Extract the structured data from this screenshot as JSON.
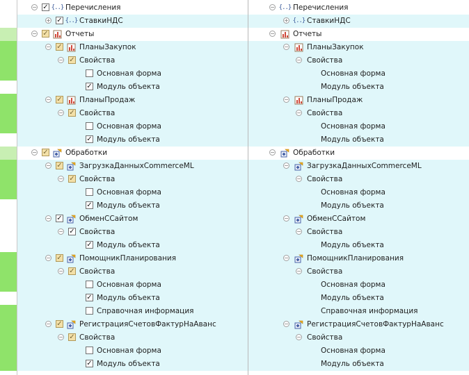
{
  "colors": {
    "row_highlight": "#e0f7fa",
    "gutter_changed": "#8fe36a",
    "gutter_changed_light": "#c8efb3"
  },
  "rows": [
    {
      "level": 0,
      "expander": "minus",
      "check": "checked",
      "icon": "enum-icon",
      "left_label": "Перечисления",
      "right_label": "Перечисления",
      "highlight": false,
      "gutter": "none"
    },
    {
      "level": 1,
      "expander": "plus",
      "check": "checked",
      "icon": "enum-icon",
      "left_label": "СтавкиНДС",
      "right_label": "СтавкиНДС",
      "highlight": true,
      "gutter": "none"
    },
    {
      "level": 0,
      "expander": "minus",
      "check": "partial",
      "icon": "report-icon",
      "left_label": "Отчеты",
      "right_label": "Отчеты",
      "highlight": false,
      "gutter": "light"
    },
    {
      "level": 1,
      "expander": "minus",
      "check": "partial",
      "icon": "report-icon",
      "left_label": "ПланыЗакупок",
      "right_label": "ПланыЗакупок",
      "highlight": true,
      "gutter": "strong"
    },
    {
      "level": 2,
      "expander": "minus",
      "check": "partial",
      "icon": "",
      "left_label": "Свойства",
      "right_label": "Свойства",
      "highlight": true,
      "gutter": "strong"
    },
    {
      "level": 3,
      "expander": "",
      "check": "unchecked",
      "icon": "",
      "left_label": "Основная форма",
      "right_label": "Основная форма",
      "highlight": true,
      "gutter": "strong"
    },
    {
      "level": 3,
      "expander": "",
      "check": "checked",
      "icon": "",
      "left_label": "Модуль объекта",
      "right_label": "Модуль объекта",
      "highlight": true,
      "gutter": "none"
    },
    {
      "level": 1,
      "expander": "minus",
      "check": "partial",
      "icon": "report-icon",
      "left_label": "ПланыПродаж",
      "right_label": "ПланыПродаж",
      "highlight": true,
      "gutter": "strong"
    },
    {
      "level": 2,
      "expander": "minus",
      "check": "partial",
      "icon": "",
      "left_label": "Свойства",
      "right_label": "Свойства",
      "highlight": true,
      "gutter": "strong"
    },
    {
      "level": 3,
      "expander": "",
      "check": "unchecked",
      "icon": "",
      "left_label": "Основная форма",
      "right_label": "Основная форма",
      "highlight": true,
      "gutter": "strong"
    },
    {
      "level": 3,
      "expander": "",
      "check": "checked",
      "icon": "",
      "left_label": "Модуль объекта",
      "right_label": "Модуль объекта",
      "highlight": true,
      "gutter": "none"
    },
    {
      "level": 0,
      "expander": "minus",
      "check": "partial",
      "icon": "processing-icon",
      "left_label": "Обработки",
      "right_label": "Обработки",
      "highlight": false,
      "gutter": "light"
    },
    {
      "level": 1,
      "expander": "minus",
      "check": "partial",
      "icon": "processing-icon",
      "left_label": "ЗагрузкаДанныхCommerceML",
      "right_label": "ЗагрузкаДанныхCommerceML",
      "highlight": true,
      "gutter": "strong"
    },
    {
      "level": 2,
      "expander": "minus",
      "check": "partial",
      "icon": "",
      "left_label": "Свойства",
      "right_label": "Свойства",
      "highlight": true,
      "gutter": "strong"
    },
    {
      "level": 3,
      "expander": "",
      "check": "unchecked",
      "icon": "",
      "left_label": "Основная форма",
      "right_label": "Основная форма",
      "highlight": true,
      "gutter": "strong"
    },
    {
      "level": 3,
      "expander": "",
      "check": "checked",
      "icon": "",
      "left_label": "Модуль объекта",
      "right_label": "Модуль объекта",
      "highlight": true,
      "gutter": "none"
    },
    {
      "level": 1,
      "expander": "minus",
      "check": "checked",
      "icon": "processing-icon",
      "left_label": "ОбменССайтом",
      "right_label": "ОбменССайтом",
      "highlight": true,
      "gutter": "none"
    },
    {
      "level": 2,
      "expander": "minus",
      "check": "checked",
      "icon": "",
      "left_label": "Свойства",
      "right_label": "Свойства",
      "highlight": true,
      "gutter": "none"
    },
    {
      "level": 3,
      "expander": "",
      "check": "checked",
      "icon": "",
      "left_label": "Модуль объекта",
      "right_label": "Модуль объекта",
      "highlight": true,
      "gutter": "none"
    },
    {
      "level": 1,
      "expander": "minus",
      "check": "partial",
      "icon": "processing-icon",
      "left_label": "ПомощникПланирования",
      "right_label": "ПомощникПланирования",
      "highlight": true,
      "gutter": "strong"
    },
    {
      "level": 2,
      "expander": "minus",
      "check": "partial",
      "icon": "",
      "left_label": "Свойства",
      "right_label": "Свойства",
      "highlight": true,
      "gutter": "strong"
    },
    {
      "level": 3,
      "expander": "",
      "check": "unchecked",
      "icon": "",
      "left_label": "Основная форма",
      "right_label": "Основная форма",
      "highlight": true,
      "gutter": "strong"
    },
    {
      "level": 3,
      "expander": "",
      "check": "checked",
      "icon": "",
      "left_label": "Модуль объекта",
      "right_label": "Модуль объекта",
      "highlight": true,
      "gutter": "none"
    },
    {
      "level": 3,
      "expander": "",
      "check": "unchecked",
      "icon": "",
      "left_label": "Справочная информация",
      "right_label": "Справочная информация",
      "highlight": true,
      "gutter": "strong"
    },
    {
      "level": 1,
      "expander": "minus",
      "check": "partial",
      "icon": "processing-icon",
      "left_label": "РегистрацияСчетовФактурНаАванс",
      "right_label": "РегистрацияСчетовФактурНаАванс",
      "highlight": true,
      "gutter": "strong"
    },
    {
      "level": 2,
      "expander": "minus",
      "check": "partial",
      "icon": "",
      "left_label": "Свойства",
      "right_label": "Свойства",
      "highlight": true,
      "gutter": "strong"
    },
    {
      "level": 3,
      "expander": "",
      "check": "unchecked",
      "icon": "",
      "left_label": "Основная форма",
      "right_label": "Основная форма",
      "highlight": true,
      "gutter": "strong"
    },
    {
      "level": 3,
      "expander": "",
      "check": "checked",
      "icon": "",
      "left_label": "Модуль объекта",
      "right_label": "Модуль объекта",
      "highlight": true,
      "gutter": "strong"
    }
  ]
}
